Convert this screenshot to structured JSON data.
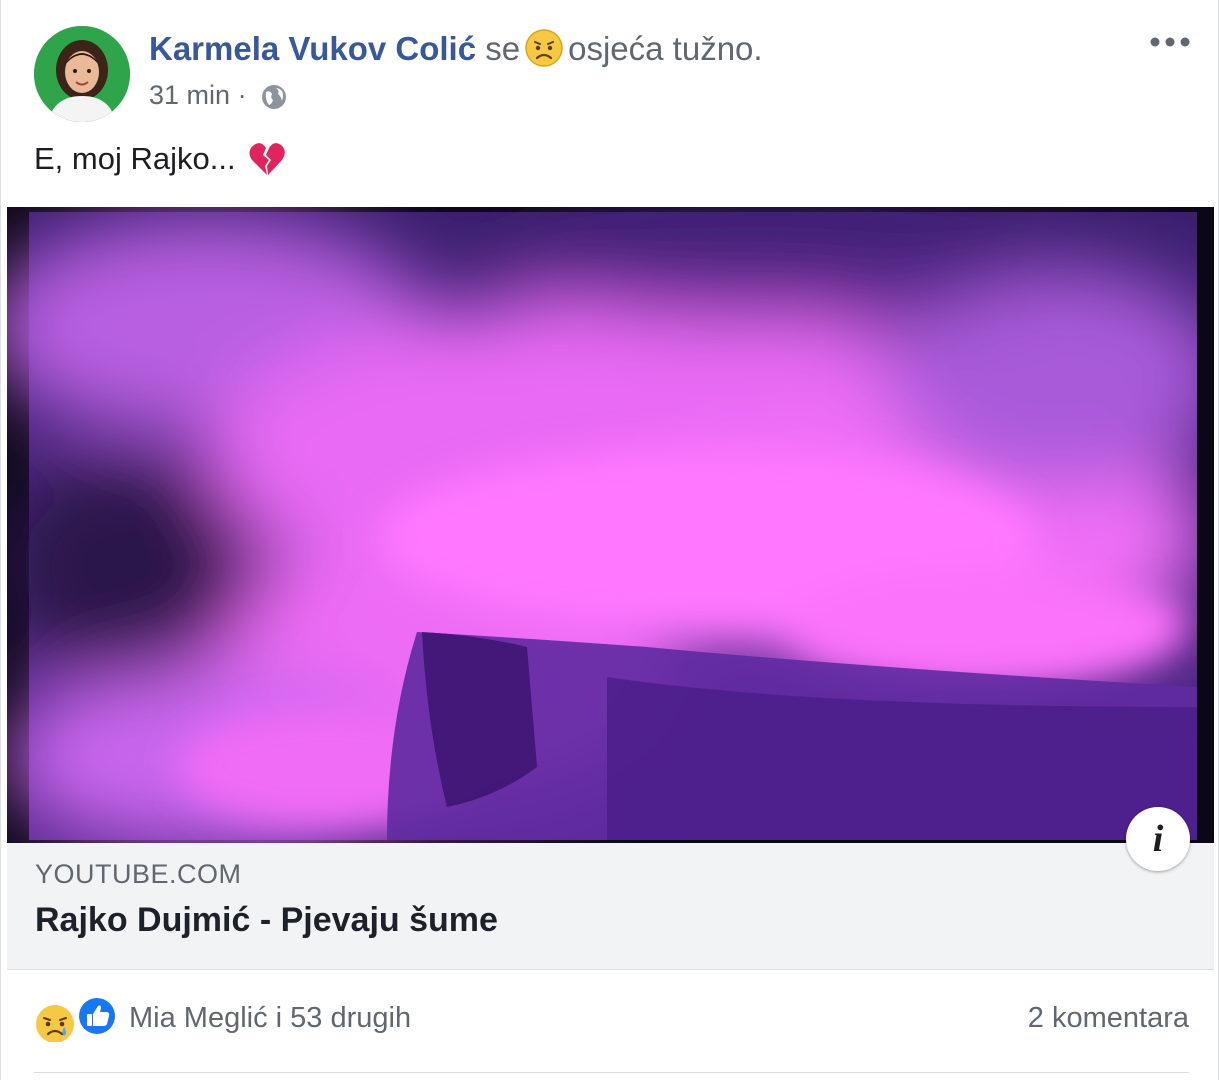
{
  "post": {
    "author": "Karmela Vukov Colić",
    "feeling_prefix": "se",
    "feeling_emoji": "sad-face-emoji",
    "feeling_text": "osjeća tužno.",
    "time": "31 min",
    "separator": "·",
    "privacy_icon": "globe-icon",
    "more_icon": "more-options-icon",
    "text": "E, moj Rajko...",
    "text_emoji": "broken-heart-icon"
  },
  "link_preview": {
    "domain": "YOUTUBE.COM",
    "title": "Rajko Dujmić - Pjevaju šume",
    "info_label": "i"
  },
  "footer": {
    "reaction_icons": [
      "sad-reaction-icon",
      "like-reaction-icon"
    ],
    "reaction_text": "Mia Meglić i 53 drugih",
    "comment_text": "2 komentara"
  },
  "colors": {
    "author_link": "#385898",
    "secondary_text": "#606770",
    "link_box_bg": "#f2f3f5",
    "like_blue": "#1877f2",
    "heart_red": "#e0245e"
  }
}
